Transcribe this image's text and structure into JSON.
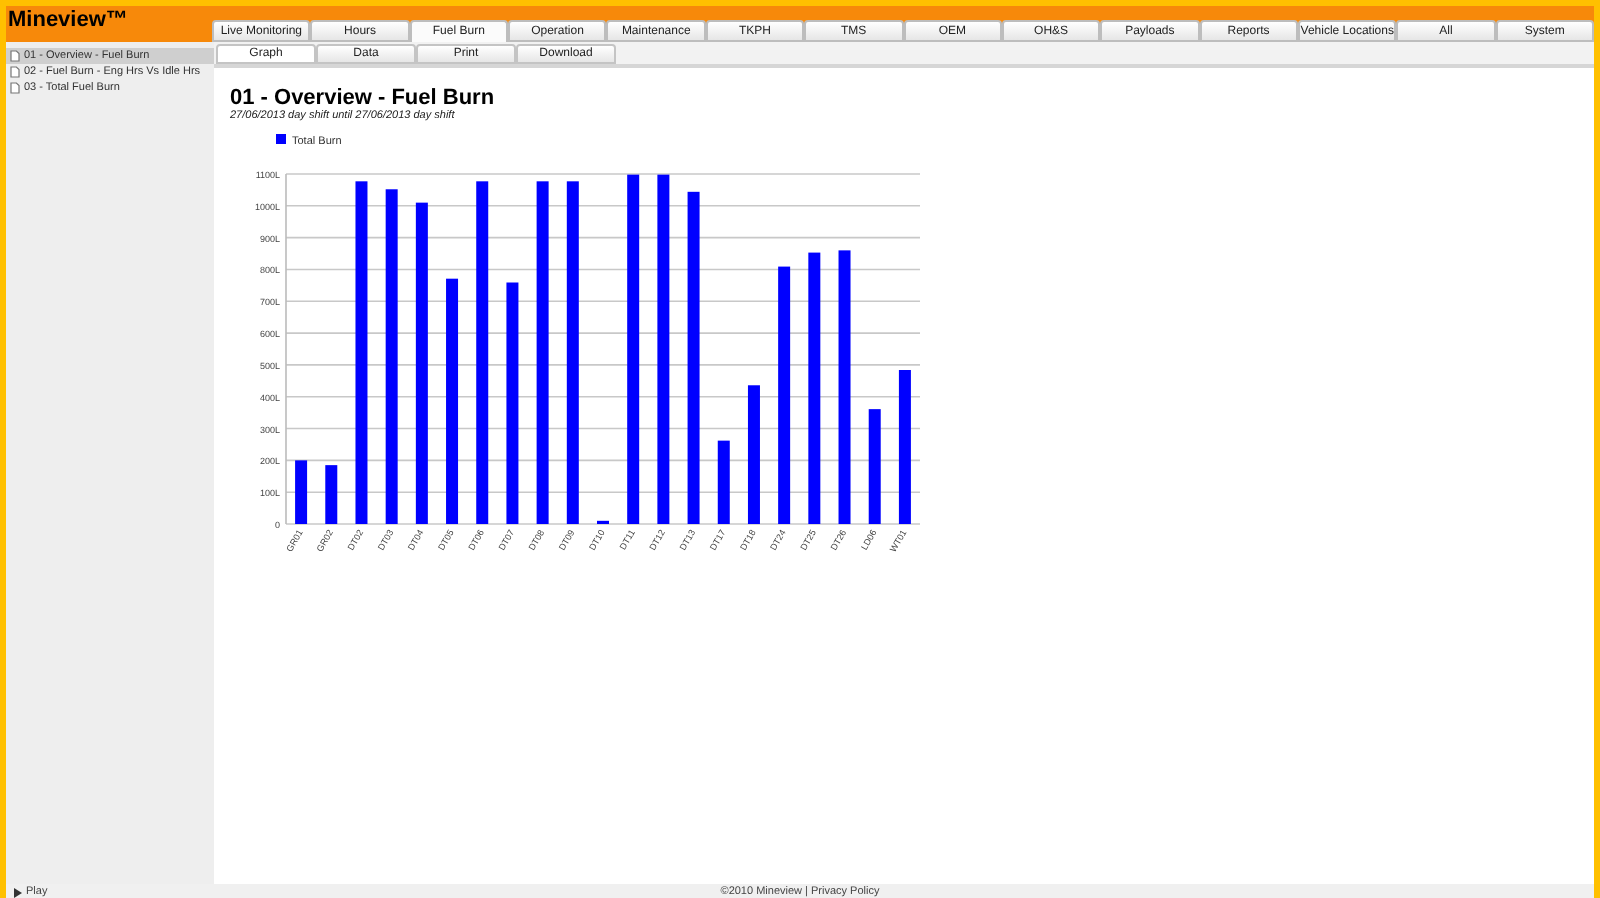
{
  "app": {
    "title": "Mineview™"
  },
  "tabs": [
    {
      "label": "Live Monitoring",
      "selected": false
    },
    {
      "label": "Hours",
      "selected": false
    },
    {
      "label": "Fuel Burn",
      "selected": true
    },
    {
      "label": "Operation",
      "selected": false
    },
    {
      "label": "Maintenance",
      "selected": false
    },
    {
      "label": "TKPH",
      "selected": false
    },
    {
      "label": "TMS",
      "selected": false
    },
    {
      "label": "OEM",
      "selected": false
    },
    {
      "label": "OH&S",
      "selected": false
    },
    {
      "label": "Payloads",
      "selected": false
    },
    {
      "label": "Reports",
      "selected": false
    },
    {
      "label": "Vehicle Locations",
      "selected": false
    },
    {
      "label": "All",
      "selected": false
    },
    {
      "label": "System",
      "selected": false
    }
  ],
  "subtabs": [
    {
      "label": "Graph",
      "selected": true
    },
    {
      "label": "Data",
      "selected": false
    },
    {
      "label": "Print",
      "selected": false
    },
    {
      "label": "Download",
      "selected": false
    }
  ],
  "sidebar": {
    "items": [
      {
        "label": "01 - Overview - Fuel Burn",
        "selected": true
      },
      {
        "label": "02 - Fuel Burn - Eng Hrs Vs Idle Hrs",
        "selected": false
      },
      {
        "label": "03 - Total Fuel Burn",
        "selected": false
      }
    ]
  },
  "report": {
    "title": "01 - Overview - Fuel Burn",
    "subtitle": "27/06/2013 day shift until 27/06/2013 day shift",
    "chart_data": {
      "type": "bar",
      "categories": [
        "GR01",
        "GR02",
        "DT02",
        "DT03",
        "DT04",
        "DT05",
        "DT06",
        "DT07",
        "DT08",
        "DT09",
        "DT10",
        "DT11",
        "DT12",
        "DT13",
        "DT17",
        "DT18",
        "DT24",
        "DT25",
        "DT26",
        "LD06",
        "WT01"
      ],
      "series": [
        {
          "name": "Total Burn",
          "color": "#0000ff",
          "values": [
            200,
            185,
            1077,
            1052,
            1010,
            771,
            1077,
            759,
            1077,
            1077,
            10,
            1098,
            1098,
            1044,
            262,
            436,
            809,
            853,
            860,
            361,
            484
          ]
        }
      ],
      "ylim": [
        0,
        1100
      ],
      "grid": true,
      "yticks": [
        {
          "value": 0,
          "label": "0"
        },
        {
          "value": 100,
          "label": "100L"
        },
        {
          "value": 200,
          "label": "200L"
        },
        {
          "value": 300,
          "label": "300L"
        },
        {
          "value": 400,
          "label": "400L"
        },
        {
          "value": 500,
          "label": "500L"
        },
        {
          "value": 600,
          "label": "600L"
        },
        {
          "value": 700,
          "label": "700L"
        },
        {
          "value": 800,
          "label": "800L"
        },
        {
          "value": 900,
          "label": "900L"
        },
        {
          "value": 1000,
          "label": "1000L"
        },
        {
          "value": 1100,
          "label": "1100L"
        }
      ]
    }
  },
  "footer": {
    "left": "Play",
    "center": "©2010 Mineview | Privacy Policy"
  }
}
